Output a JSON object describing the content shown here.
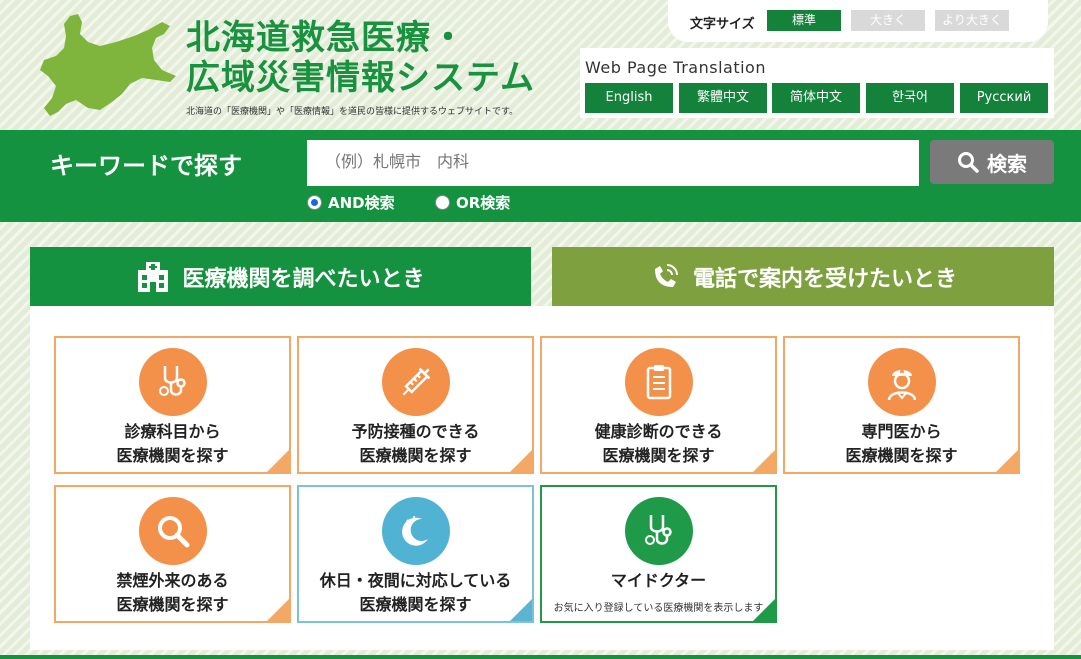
{
  "header": {
    "title_line1": "北海道救急医療・",
    "title_line2": "広域災害情報システム",
    "tagline": "北海道の「医療機関」や「医療情報」を道民の皆様に提供するウェブサイトです。"
  },
  "font_size": {
    "label": "文字サイズ",
    "options": [
      "標準",
      "大きく",
      "より大きく"
    ],
    "selected": "標準"
  },
  "translation": {
    "label": "Web Page Translation",
    "languages": [
      "English",
      "繁體中文",
      "简体中文",
      "한국어",
      "Русский"
    ]
  },
  "search": {
    "title": "キーワードで探す",
    "placeholder": "（例）札幌市　内科",
    "button_label": "検索",
    "modes": [
      {
        "label": "AND検索",
        "checked": true
      },
      {
        "label": "OR検索",
        "checked": false
      }
    ]
  },
  "tabs": [
    {
      "label": "医療機関を調べたいとき",
      "active": true
    },
    {
      "label": "電話で案内を受けたいとき",
      "active": false
    }
  ],
  "cards": [
    {
      "line1": "診療科目から",
      "line2": "医療機関を探す",
      "icon": "stethoscope-icon"
    },
    {
      "line1": "予防接種のできる",
      "line2": "医療機関を探す",
      "icon": "syringe-icon"
    },
    {
      "line1": "健康診断のできる",
      "line2": "医療機関を探す",
      "icon": "clipboard-icon"
    },
    {
      "line1": "専門医から",
      "line2": "医療機関を探す",
      "icon": "doctor-icon"
    },
    {
      "line1": "禁煙外来のある",
      "line2": "医療機関を探す",
      "icon": "magnifier-icon"
    },
    {
      "line1": "休日・夜間に対応している",
      "line2": "医療機関を探す",
      "icon": "moon-icon"
    },
    {
      "line1": "マイドクター",
      "line2": "お気に入り登録している医療機関を表示します",
      "icon": "stethoscope-icon"
    }
  ],
  "colors": {
    "brand_green": "#14923f",
    "olive_green": "#7fa03f",
    "orange": "#f3914a",
    "blue": "#50b3d3"
  }
}
